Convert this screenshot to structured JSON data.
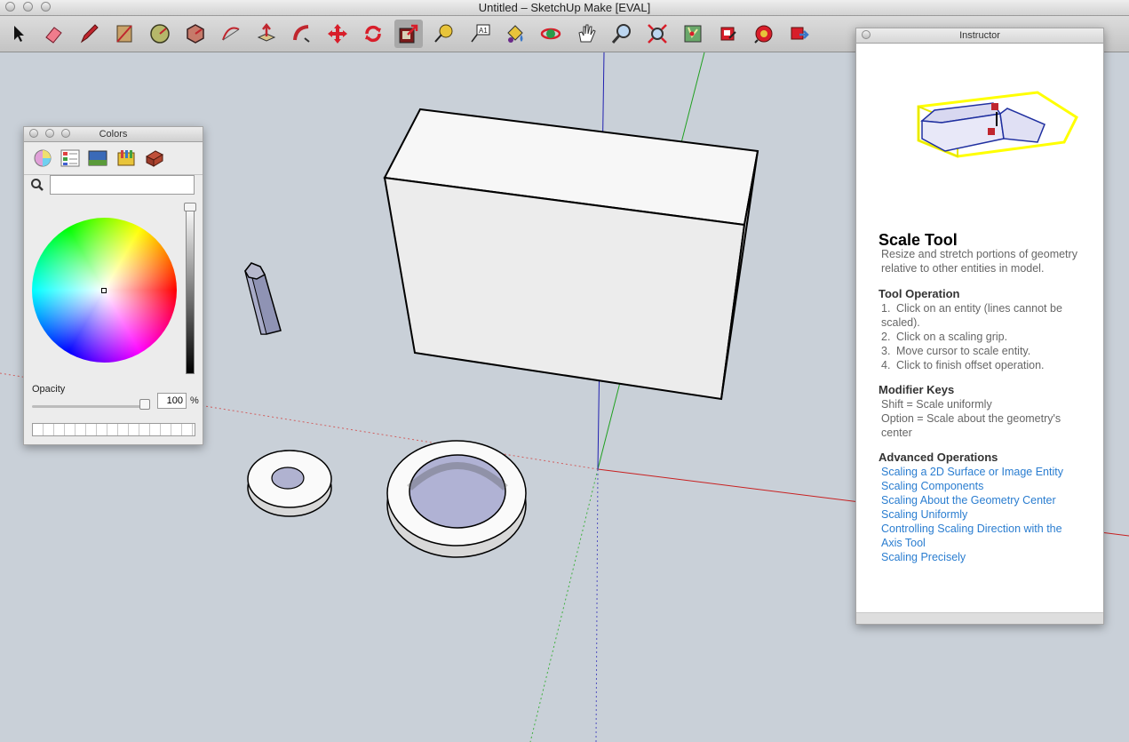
{
  "window": {
    "title": "Untitled – SketchUp Make [EVAL]"
  },
  "toolbar": {
    "tools": [
      "select-tool",
      "eraser-tool",
      "pencil-tool",
      "rectangle-tool",
      "circle-tool",
      "polygon-tool",
      "arc-tool",
      "push-pull-tool",
      "follow-me-tool",
      "move-tool",
      "rotate-tool",
      "scale-tool",
      "tape-measure-tool",
      "text-tool",
      "paint-bucket-tool",
      "orbit-tool",
      "pan-tool",
      "zoom-tool",
      "zoom-extents-tool",
      "add-location-tool",
      "get-models-tool",
      "share-model-tool",
      "extension-warehouse-tool",
      "send-to-layout-tool"
    ],
    "active": "scale-tool"
  },
  "colors_panel": {
    "title": "Colors",
    "opacity_label": "Opacity",
    "opacity_value": "100",
    "opacity_unit": "%",
    "accent": "#ffffff"
  },
  "instructor": {
    "panel_title": "Instructor",
    "title": "Scale Tool",
    "description": "Resize and stretch portions of geometry relative to other entities in model.",
    "operation_heading": "Tool Operation",
    "operations": [
      {
        "num": "1.",
        "text": "Click on an entity (lines cannot be",
        "cont": "scaled)."
      },
      {
        "num": "2.",
        "text": "Click on a scaling grip."
      },
      {
        "num": "3.",
        "text": "Move cursor to scale entity."
      },
      {
        "num": "4.",
        "text": "Click to finish offset operation."
      }
    ],
    "modifier_heading": "Modifier Keys",
    "modifiers": [
      "Shift = Scale uniformly",
      "Option = Scale about the geometry's",
      "center"
    ],
    "advanced_heading": "Advanced Operations",
    "links": [
      "Scaling a 2D Surface or Image Entity",
      "Scaling Components",
      "Scaling About the Geometry Center",
      "Scaling Uniformly",
      "Controlling Scaling Direction with the",
      "Axis Tool",
      "Scaling Precisely"
    ],
    "link_color": "#2a7dd0"
  }
}
